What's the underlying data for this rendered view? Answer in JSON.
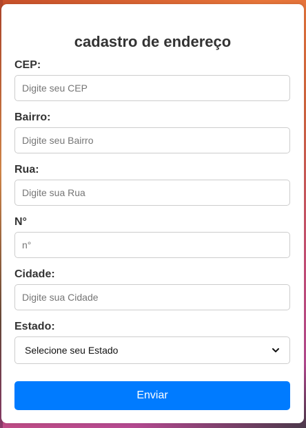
{
  "form": {
    "title": "cadastro de endereço",
    "fields": [
      {
        "label": "CEP:",
        "placeholder": "Digite seu CEP"
      },
      {
        "label": "Bairro:",
        "placeholder": "Digite seu Bairro"
      },
      {
        "label": "Rua:",
        "placeholder": "Digite sua Rua"
      },
      {
        "label": "N°",
        "placeholder": "n°"
      },
      {
        "label": "Cidade:",
        "placeholder": "Digite sua Cidade"
      }
    ],
    "estado": {
      "label": "Estado:",
      "selected": "Selecione seu Estado"
    },
    "submit_label": "Enviar"
  },
  "colors": {
    "accent": "#007bff",
    "text": "#333333",
    "card": "#ffffff"
  }
}
